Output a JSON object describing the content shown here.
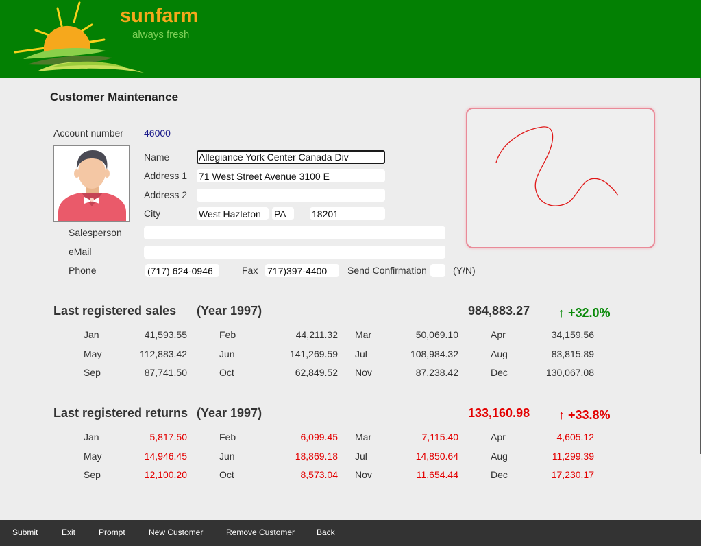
{
  "brand": {
    "name": "sunfarm",
    "tagline": "always fresh"
  },
  "page": {
    "title": "Customer Maintenance"
  },
  "customer": {
    "account_label": "Account number",
    "account_value": "46000",
    "name_label": "Name",
    "name_value": "Allegiance York Center Canada Div",
    "address1_label": "Address 1",
    "address1_value": "71 West Street Avenue 3100 E",
    "address2_label": "Address 2",
    "address2_value": "",
    "city_label": "City",
    "city_value": "West Hazleton",
    "state_value": "PA",
    "zip_value": "18201",
    "salesperson_label": "Salesperson",
    "salesperson_value": "",
    "email_label": "eMail",
    "email_value": "",
    "phone_label": "Phone",
    "phone_value": "(717) 624-0946",
    "fax_label": "Fax",
    "fax_value": "717)397-4400",
    "confirm_label": "Send Confirmation",
    "confirm_value": "",
    "confirm_hint": "(Y/N)"
  },
  "sales": {
    "title": "Last registered sales",
    "year": "(Year 1997)",
    "total": "984,883.27",
    "change": "↑ +32.0%",
    "months": [
      {
        "m": "Jan",
        "v": "41,593.55"
      },
      {
        "m": "Feb",
        "v": "44,211.32"
      },
      {
        "m": "Mar",
        "v": "50,069.10"
      },
      {
        "m": "Apr",
        "v": "34,159.56"
      },
      {
        "m": "May",
        "v": "112,883.42"
      },
      {
        "m": "Jun",
        "v": "141,269.59"
      },
      {
        "m": "Jul",
        "v": "108,984.32"
      },
      {
        "m": "Aug",
        "v": "83,815.89"
      },
      {
        "m": "Sep",
        "v": "87,741.50"
      },
      {
        "m": "Oct",
        "v": "62,849.52"
      },
      {
        "m": "Nov",
        "v": "87,238.42"
      },
      {
        "m": "Dec",
        "v": "130,067.08"
      }
    ]
  },
  "returns": {
    "title": "Last registered returns",
    "year": "(Year 1997)",
    "total": "133,160.98",
    "change": "↑ +33.8%",
    "months": [
      {
        "m": "Jan",
        "v": "5,817.50"
      },
      {
        "m": "Feb",
        "v": "6,099.45"
      },
      {
        "m": "Mar",
        "v": "7,115.40"
      },
      {
        "m": "Apr",
        "v": "4,605.12"
      },
      {
        "m": "May",
        "v": "14,946.45"
      },
      {
        "m": "Jun",
        "v": "18,869.18"
      },
      {
        "m": "Jul",
        "v": "14,850.64"
      },
      {
        "m": "Aug",
        "v": "11,299.39"
      },
      {
        "m": "Sep",
        "v": "12,100.20"
      },
      {
        "m": "Oct",
        "v": "8,573.04"
      },
      {
        "m": "Nov",
        "v": "11,654.44"
      },
      {
        "m": "Dec",
        "v": "17,230.17"
      }
    ]
  },
  "colors": {
    "header_bg": "#038003",
    "brand_orange": "#f6a81c",
    "positive_green": "#0a8a0a",
    "negative_red": "#e30000",
    "footer_bg": "#333333"
  },
  "footer": {
    "submit": "Submit",
    "exit": "Exit",
    "prompt": "Prompt",
    "new_customer": "New Customer",
    "remove_customer": "Remove Customer",
    "back": "Back"
  },
  "icons": {
    "logo": "sun-logo-icon",
    "photo": "customer-avatar-icon",
    "signature": "signature-pad"
  }
}
